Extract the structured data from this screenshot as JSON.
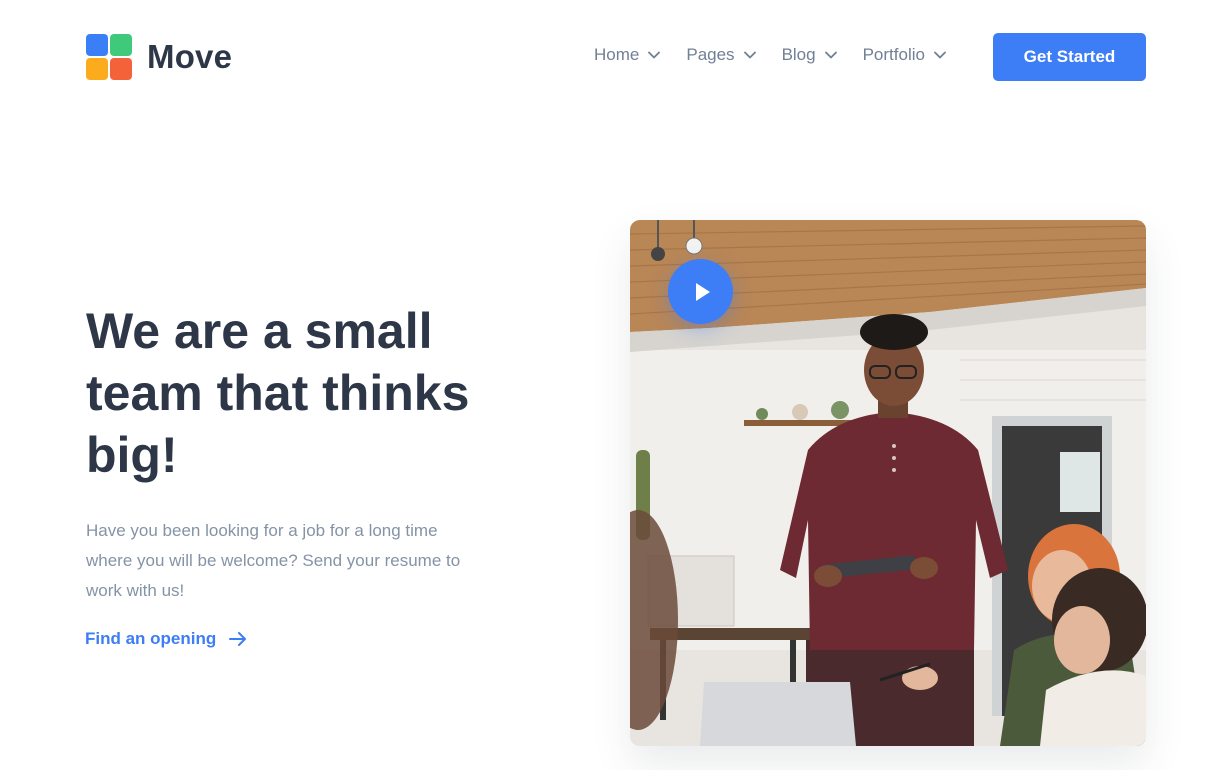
{
  "brand": {
    "name": "Move",
    "logo_colors": [
      "#3b7ff6",
      "#3ec97b",
      "#fbab1b",
      "#f4623a"
    ]
  },
  "nav": {
    "items": [
      {
        "label": "Home",
        "icon": "chevron-down-icon"
      },
      {
        "label": "Pages",
        "icon": "chevron-down-icon"
      },
      {
        "label": "Blog",
        "icon": "chevron-down-icon"
      },
      {
        "label": "Portfolio",
        "icon": "chevron-down-icon"
      }
    ],
    "cta_label": "Get Started"
  },
  "hero": {
    "title": "We are a small team that thinks big!",
    "description": "Have you been looking for a job for a long time where you will be welcome? Send your resume to work with us!",
    "link_label": "Find an opening",
    "link_icon": "arrow-right-icon",
    "media_icon": "play-icon"
  },
  "colors": {
    "accent": "#3d7df5",
    "heading": "#2d3748",
    "muted": "#8593a6",
    "nav_text": "#718096"
  }
}
